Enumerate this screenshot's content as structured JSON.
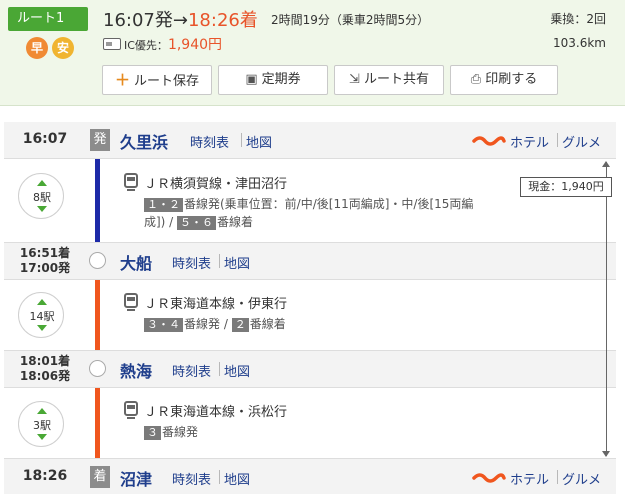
{
  "route": {
    "badge": "ルート1",
    "mini_icons": [
      "早",
      "安"
    ],
    "depart": "16:07発",
    "arrow": "→",
    "arrive": "18:26着",
    "duration": "2時間19分（乗車2時間5分）",
    "fare_label": "IC優先：",
    "fare_value": "1,940円",
    "transfers": "乗換：2回",
    "distance": "103.6km",
    "buttons": {
      "save": "ルート保存",
      "pass": "定期券",
      "share": "ルート共有",
      "print": "印刷する"
    }
  },
  "stations": [
    {
      "time": "16:07",
      "tag": "発",
      "name": "久里浜",
      "timetable": "時刻表",
      "map": "地図",
      "hotel": "ホテル",
      "gourmet": "グルメ"
    },
    {
      "time_arr": "16:51着",
      "time_dep": "17:00発",
      "name": "大船",
      "timetable": "時刻表",
      "map": "地図"
    },
    {
      "time_arr": "18:01着",
      "time_dep": "18:06発",
      "name": "熱海",
      "timetable": "時刻表",
      "map": "地図"
    },
    {
      "time": "18:26",
      "tag": "着",
      "name": "沼津",
      "timetable": "時刻表",
      "map": "地図",
      "hotel": "ホテル",
      "gourmet": "グルメ"
    }
  ],
  "segments": [
    {
      "stops": "8駅",
      "train": "ＪＲ横須賀線・津田沼行",
      "dep_platform": "１・２",
      "dep_text": "番線発(乗車位置：前/中/後[11両編成]・中/後[15両編",
      "dep_text2": "成]) / ",
      "arr_platform": "５・６",
      "arr_text": "番線着",
      "line_color": "#1d2aa8"
    },
    {
      "stops": "14駅",
      "train": "ＪＲ東海道本線・伊東行",
      "dep_platform": "３・４",
      "dep_text": "番線発 / ",
      "arr_platform": "２",
      "arr_text": "番線着",
      "line_color": "#f0561e"
    },
    {
      "stops": "3駅",
      "train": "ＪＲ東海道本線・浜松行",
      "dep_platform": "３",
      "dep_text": "番線発",
      "line_color": "#f0561e"
    }
  ],
  "fare_box": "現金：1,940円"
}
